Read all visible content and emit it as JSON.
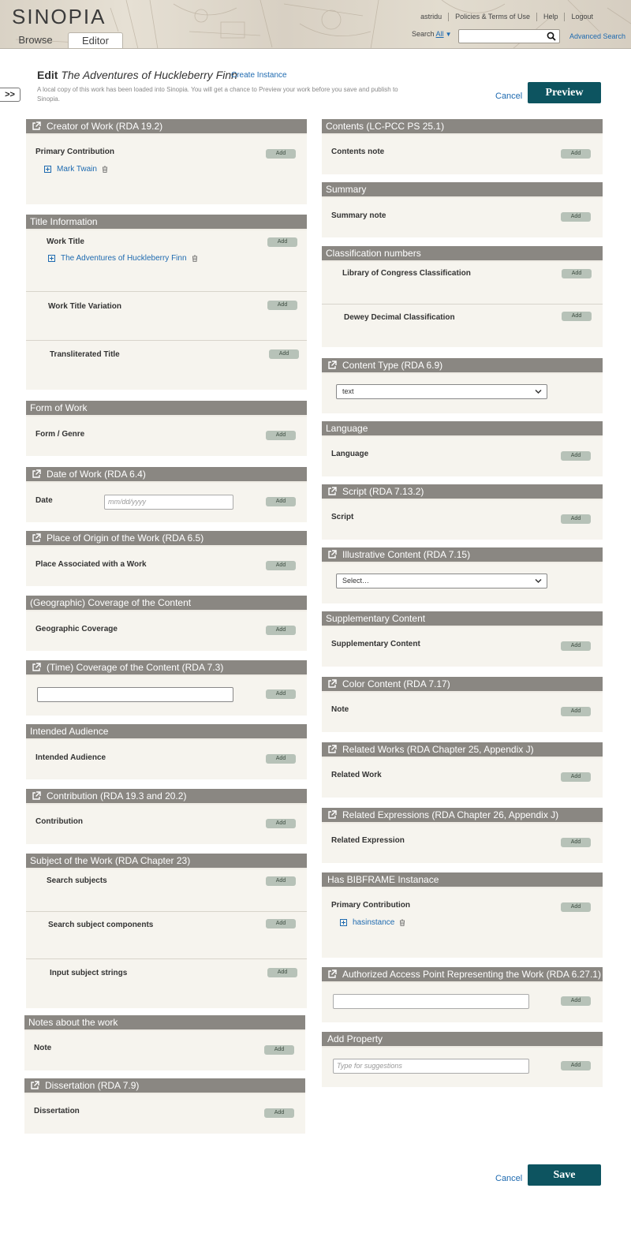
{
  "header": {
    "logo": "SINOPIA",
    "tabs": {
      "browse": "Browse",
      "editor": "Editor"
    },
    "nav": {
      "user": "astridu",
      "policies": "Policies & Terms of Use",
      "help": "Help",
      "logout": "Logout"
    },
    "search": {
      "label": "Search",
      "scope": "All",
      "value": "",
      "advanced": "Advanced Search"
    }
  },
  "toggle": ">>",
  "edit": {
    "title_prefix": "Edit",
    "title_work": "The Adventures of Huckleberry Finn",
    "create_instance": "Create Instance",
    "intro": "A local copy of this work has been loaded into Sinopia. You will get a chance to Preview your work before you save and publish to Sinopia.",
    "cancel": "Cancel",
    "preview": "Preview",
    "save": "Save"
  },
  "add_label": "Add",
  "left": {
    "creator": {
      "title": "Creator of Work (RDA 19.2)",
      "prop": "Primary Contribution",
      "value": "Mark Twain"
    },
    "title_info": {
      "title": "Title Information",
      "work_title": "Work Title",
      "work_title_value": "The Adventures of Huckleberry Finn",
      "variation": "Work Title Variation",
      "transliterated": "Transliterated Title"
    },
    "form": {
      "title": "Form of Work",
      "prop": "Form / Genre"
    },
    "date": {
      "title": "Date of Work (RDA 6.4)",
      "prop": "Date",
      "placeholder": "mm/dd/yyyy"
    },
    "place": {
      "title": "Place of Origin of the Work (RDA 6.5)",
      "prop": "Place Associated with a Work"
    },
    "geo": {
      "title": "(Geographic) Coverage of the Content",
      "prop": "Geographic Coverage"
    },
    "time": {
      "title": "(Time) Coverage of the Content (RDA 7.3)",
      "value": ""
    },
    "audience": {
      "title": "Intended Audience",
      "prop": "Intended Audience"
    },
    "contribution": {
      "title": "Contribution (RDA 19.3 and 20.2)",
      "prop": "Contribution"
    },
    "subject": {
      "title": "Subject of the Work (RDA Chapter 23)",
      "search": "Search subjects",
      "components": "Search subject components",
      "strings": "Input subject strings"
    },
    "notes": {
      "title": "Notes about the work",
      "prop": "Note"
    },
    "dissertation": {
      "title": "Dissertation (RDA 7.9)",
      "prop": "Dissertation"
    }
  },
  "right": {
    "contents": {
      "title": "Contents (LC-PCC PS 25.1)",
      "prop": "Contents note"
    },
    "summary": {
      "title": "Summary",
      "prop": "Summary note"
    },
    "classification": {
      "title": "Classification numbers",
      "lcc": "Library of Congress Classification",
      "ddc": "Dewey Decimal Classification"
    },
    "content_type": {
      "title": "Content Type (RDA 6.9)",
      "selected": "text"
    },
    "language": {
      "title": "Language",
      "prop": "Language"
    },
    "script": {
      "title": "Script (RDA 7.13.2)",
      "prop": "Script"
    },
    "illustrative": {
      "title": "Illustrative Content (RDA 7.15)",
      "selected": "Select…"
    },
    "supplementary": {
      "title": "Supplementary Content",
      "prop": "Supplementary Content"
    },
    "color": {
      "title": "Color Content (RDA 7.17)",
      "prop": "Note"
    },
    "related_works": {
      "title": "Related Works (RDA Chapter 25, Appendix J)",
      "prop": "Related Work"
    },
    "related_expr": {
      "title": "Related Expressions (RDA Chapter 26, Appendix J)",
      "prop": "Related Expression"
    },
    "bibframe": {
      "title": "Has BIBFRAME Instanace",
      "prop": "Primary Contribution",
      "value": "hasinstance"
    },
    "access_point": {
      "title": "Authorized Access Point Representing the Work (RDA 6.27.1)",
      "value": ""
    },
    "add_property": {
      "title": "Add Property",
      "placeholder": "Type for suggestions"
    }
  }
}
